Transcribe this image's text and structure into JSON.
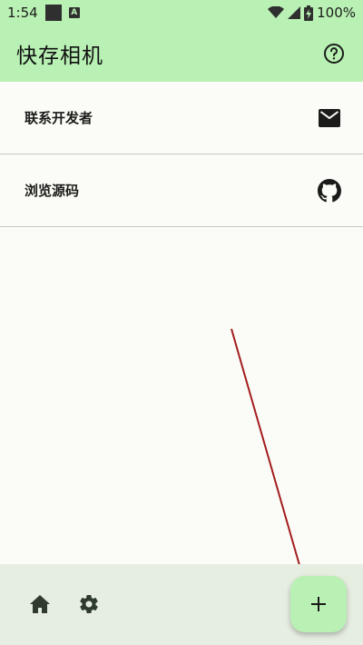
{
  "status_bar": {
    "time": "1:54",
    "battery_percent": "100%",
    "icons": [
      "stop-square-icon",
      "accessibility-a-icon",
      "wifi-icon",
      "signal-icon",
      "battery-charging-icon"
    ]
  },
  "app_bar": {
    "title": "快存相机",
    "help_icon": "help-circle-icon"
  },
  "menu": {
    "items": [
      {
        "label": "联系开发者",
        "icon": "mail-icon"
      },
      {
        "label": "浏览源码",
        "icon": "github-icon"
      }
    ]
  },
  "bottom_bar": {
    "icons": [
      "home-icon",
      "settings-gear-icon"
    ],
    "fab_icon": "plus-icon"
  },
  "colors": {
    "accent": "#b9f1b4",
    "background": "#fbfcf7",
    "bottom_bar": "#e6ede1",
    "annotation_arrow": "#a31d1d"
  }
}
